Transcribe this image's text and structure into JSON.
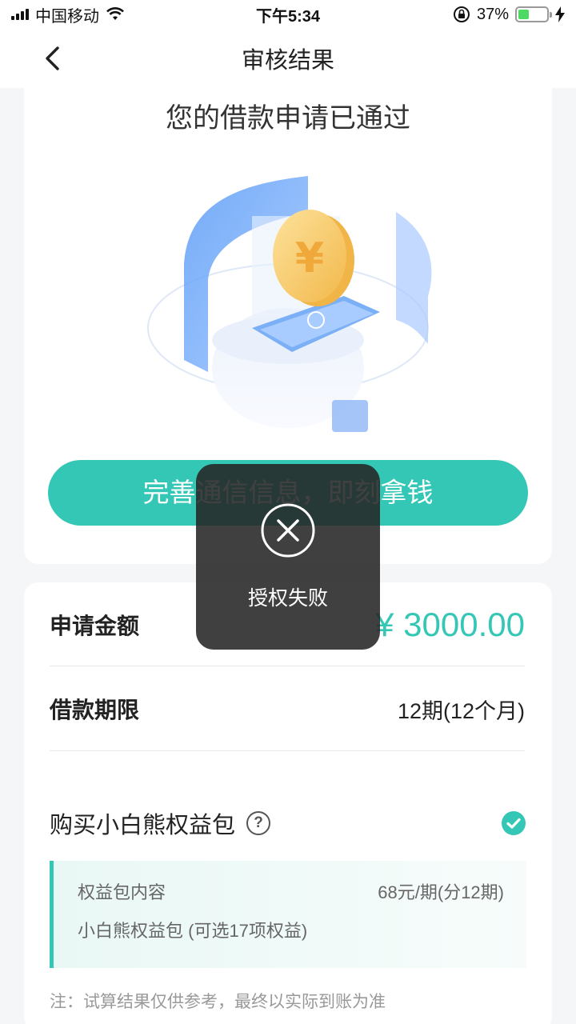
{
  "status_bar": {
    "carrier": "中国移动",
    "time": "下午5:34",
    "battery": "37%",
    "battery_level": 0.37
  },
  "nav": {
    "title": "审核结果",
    "back_icon": "chevron-left-icon"
  },
  "result": {
    "title": "您的借款申请已通过",
    "cta_label": "完善通信信息，即刻拿钱"
  },
  "details": {
    "amount_label": "申请金额",
    "amount_value": "¥ 3000.00",
    "term_label": "借款期限",
    "term_value": "12期(12个月)",
    "package_label": "购买小白熊权益包",
    "help_glyph": "?",
    "package_checked": true,
    "package_content_label": "权益包内容",
    "package_price": "68元/期(分12期)",
    "package_desc": "小白熊权益包 (可选17项权益)",
    "note": "注：试算结果仅供参考，最终以实际到账为准"
  },
  "toast": {
    "message": "授权失败",
    "icon": "close-circle-icon"
  },
  "colors": {
    "accent": "#35c7b6",
    "toast_bg": "#262626"
  }
}
